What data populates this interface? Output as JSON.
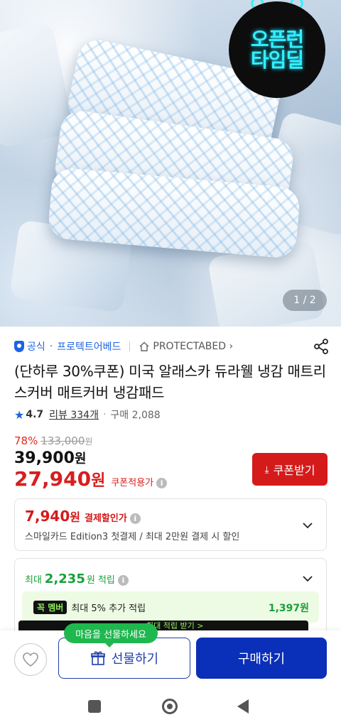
{
  "hero": {
    "badge_line1": "오픈런",
    "badge_line2": "타임딜",
    "image_counter": "1 / 2"
  },
  "store": {
    "official_label": "공식",
    "store_name": "프로텍트어베드",
    "brand_link": "PROTECTABED"
  },
  "product": {
    "title": "(단하루 30%쿠폰) 미국 알래스카 듀라웰 냉감 매트리스커버 매트커버 냉감패드",
    "rating": "4.7",
    "reviews": "리뷰 334개",
    "purchases": "구매 2,088"
  },
  "price": {
    "discount_rate": "78%",
    "original_price": "133,000",
    "original_unit": "원",
    "sale_price": "39,900",
    "sale_unit": "원",
    "coupon_price": "27,940",
    "coupon_unit": "원",
    "coupon_applied_label": "쿠폰적용가",
    "coupon_button": "쿠폰받기"
  },
  "payment_discount": {
    "amount": "7,940",
    "unit": "원",
    "label": "결제할인가",
    "description": "스마일카드 Edition3 첫결제 / 최대 2만원 결제 시 할인"
  },
  "reward": {
    "prefix": "최대",
    "amount": "2,235",
    "suffix": "원 적립",
    "member_tag": "멤버",
    "member_desc": "최대 5% 추가 적립",
    "member_value": "1,397원",
    "hidden_bar_text": "최대 적립 받기 >"
  },
  "bottom": {
    "gift_tooltip": "마음을 선물하세요",
    "gift_button": "선물하기",
    "buy_button": "구매하기"
  },
  "colors": {
    "accent_blue": "#0a2fb8",
    "price_red": "#d51a1a",
    "reward_green": "#18a03a"
  }
}
